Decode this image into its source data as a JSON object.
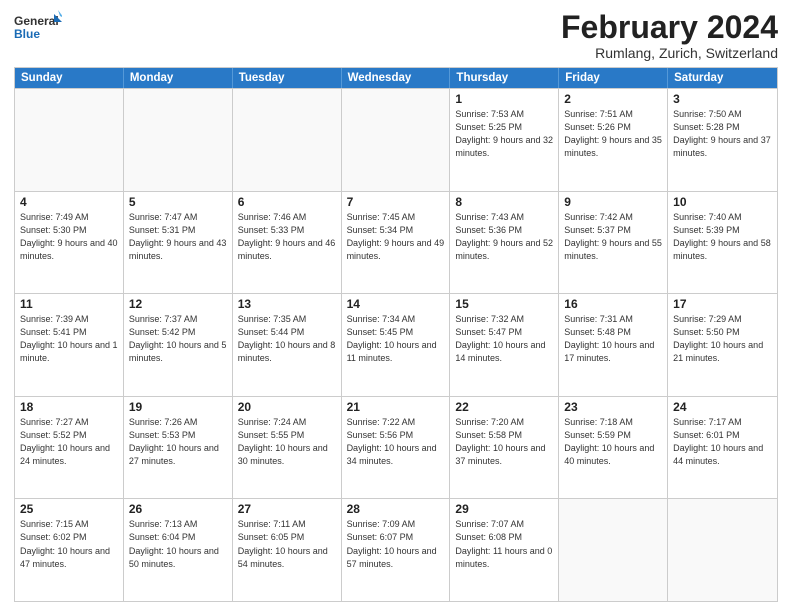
{
  "header": {
    "logo_general": "General",
    "logo_blue": "Blue",
    "month_title": "February 2024",
    "subtitle": "Rumlang, Zurich, Switzerland"
  },
  "days_of_week": [
    "Sunday",
    "Monday",
    "Tuesday",
    "Wednesday",
    "Thursday",
    "Friday",
    "Saturday"
  ],
  "weeks": [
    [
      {
        "day": "",
        "info": ""
      },
      {
        "day": "",
        "info": ""
      },
      {
        "day": "",
        "info": ""
      },
      {
        "day": "",
        "info": ""
      },
      {
        "day": "1",
        "info": "Sunrise: 7:53 AM\nSunset: 5:25 PM\nDaylight: 9 hours\nand 32 minutes."
      },
      {
        "day": "2",
        "info": "Sunrise: 7:51 AM\nSunset: 5:26 PM\nDaylight: 9 hours\nand 35 minutes."
      },
      {
        "day": "3",
        "info": "Sunrise: 7:50 AM\nSunset: 5:28 PM\nDaylight: 9 hours\nand 37 minutes."
      }
    ],
    [
      {
        "day": "4",
        "info": "Sunrise: 7:49 AM\nSunset: 5:30 PM\nDaylight: 9 hours\nand 40 minutes."
      },
      {
        "day": "5",
        "info": "Sunrise: 7:47 AM\nSunset: 5:31 PM\nDaylight: 9 hours\nand 43 minutes."
      },
      {
        "day": "6",
        "info": "Sunrise: 7:46 AM\nSunset: 5:33 PM\nDaylight: 9 hours\nand 46 minutes."
      },
      {
        "day": "7",
        "info": "Sunrise: 7:45 AM\nSunset: 5:34 PM\nDaylight: 9 hours\nand 49 minutes."
      },
      {
        "day": "8",
        "info": "Sunrise: 7:43 AM\nSunset: 5:36 PM\nDaylight: 9 hours\nand 52 minutes."
      },
      {
        "day": "9",
        "info": "Sunrise: 7:42 AM\nSunset: 5:37 PM\nDaylight: 9 hours\nand 55 minutes."
      },
      {
        "day": "10",
        "info": "Sunrise: 7:40 AM\nSunset: 5:39 PM\nDaylight: 9 hours\nand 58 minutes."
      }
    ],
    [
      {
        "day": "11",
        "info": "Sunrise: 7:39 AM\nSunset: 5:41 PM\nDaylight: 10 hours\nand 1 minute."
      },
      {
        "day": "12",
        "info": "Sunrise: 7:37 AM\nSunset: 5:42 PM\nDaylight: 10 hours\nand 5 minutes."
      },
      {
        "day": "13",
        "info": "Sunrise: 7:35 AM\nSunset: 5:44 PM\nDaylight: 10 hours\nand 8 minutes."
      },
      {
        "day": "14",
        "info": "Sunrise: 7:34 AM\nSunset: 5:45 PM\nDaylight: 10 hours\nand 11 minutes."
      },
      {
        "day": "15",
        "info": "Sunrise: 7:32 AM\nSunset: 5:47 PM\nDaylight: 10 hours\nand 14 minutes."
      },
      {
        "day": "16",
        "info": "Sunrise: 7:31 AM\nSunset: 5:48 PM\nDaylight: 10 hours\nand 17 minutes."
      },
      {
        "day": "17",
        "info": "Sunrise: 7:29 AM\nSunset: 5:50 PM\nDaylight: 10 hours\nand 21 minutes."
      }
    ],
    [
      {
        "day": "18",
        "info": "Sunrise: 7:27 AM\nSunset: 5:52 PM\nDaylight: 10 hours\nand 24 minutes."
      },
      {
        "day": "19",
        "info": "Sunrise: 7:26 AM\nSunset: 5:53 PM\nDaylight: 10 hours\nand 27 minutes."
      },
      {
        "day": "20",
        "info": "Sunrise: 7:24 AM\nSunset: 5:55 PM\nDaylight: 10 hours\nand 30 minutes."
      },
      {
        "day": "21",
        "info": "Sunrise: 7:22 AM\nSunset: 5:56 PM\nDaylight: 10 hours\nand 34 minutes."
      },
      {
        "day": "22",
        "info": "Sunrise: 7:20 AM\nSunset: 5:58 PM\nDaylight: 10 hours\nand 37 minutes."
      },
      {
        "day": "23",
        "info": "Sunrise: 7:18 AM\nSunset: 5:59 PM\nDaylight: 10 hours\nand 40 minutes."
      },
      {
        "day": "24",
        "info": "Sunrise: 7:17 AM\nSunset: 6:01 PM\nDaylight: 10 hours\nand 44 minutes."
      }
    ],
    [
      {
        "day": "25",
        "info": "Sunrise: 7:15 AM\nSunset: 6:02 PM\nDaylight: 10 hours\nand 47 minutes."
      },
      {
        "day": "26",
        "info": "Sunrise: 7:13 AM\nSunset: 6:04 PM\nDaylight: 10 hours\nand 50 minutes."
      },
      {
        "day": "27",
        "info": "Sunrise: 7:11 AM\nSunset: 6:05 PM\nDaylight: 10 hours\nand 54 minutes."
      },
      {
        "day": "28",
        "info": "Sunrise: 7:09 AM\nSunset: 6:07 PM\nDaylight: 10 hours\nand 57 minutes."
      },
      {
        "day": "29",
        "info": "Sunrise: 7:07 AM\nSunset: 6:08 PM\nDaylight: 11 hours\nand 0 minutes."
      },
      {
        "day": "",
        "info": ""
      },
      {
        "day": "",
        "info": ""
      }
    ]
  ]
}
